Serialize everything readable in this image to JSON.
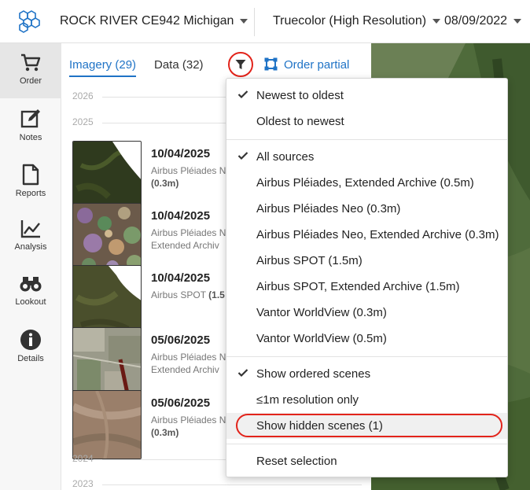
{
  "header": {
    "location": "ROCK RIVER CE942 Michigan",
    "layer": "Truecolor (High Resolution)",
    "date": "08/09/2022"
  },
  "nav": [
    {
      "label": "Order",
      "icon": "cart-icon"
    },
    {
      "label": "Notes",
      "icon": "edit-icon"
    },
    {
      "label": "Reports",
      "icon": "document-icon"
    },
    {
      "label": "Analysis",
      "icon": "line-chart-icon"
    },
    {
      "label": "Lookout",
      "icon": "binoculars-icon"
    },
    {
      "label": "Details",
      "icon": "info-icon"
    }
  ],
  "tabs": {
    "imagery": "Imagery (29)",
    "data": "Data (32)",
    "order_partial": "Order partial"
  },
  "years": [
    "2026",
    "2025",
    "2024",
    "2023"
  ],
  "scenes": [
    {
      "date": "10/04/2025",
      "source": "Airbus Pléiades N",
      "res": "(0.3m)",
      "extra": ""
    },
    {
      "date": "10/04/2025",
      "source": "Airbus Pléiades N",
      "res": "",
      "extra": "Extended Archiv"
    },
    {
      "date": "10/04/2025",
      "source": "Airbus SPOT",
      "res": "(1.5",
      "extra": ""
    },
    {
      "date": "05/06/2025",
      "source": "Airbus Pléiades N",
      "res": "",
      "extra": "Extended Archiv"
    },
    {
      "date": "05/06/2025",
      "source": "Airbus Pléiades N",
      "res": "(0.3m)",
      "extra": ""
    }
  ],
  "menu": {
    "sort": [
      {
        "label": "Newest to oldest",
        "checked": true
      },
      {
        "label": "Oldest to newest",
        "checked": false
      }
    ],
    "sources": [
      {
        "label": "All sources",
        "checked": true
      },
      {
        "label": "Airbus Pléiades, Extended Archive (0.5m)",
        "checked": false
      },
      {
        "label": "Airbus Pléiades Neo (0.3m)",
        "checked": false
      },
      {
        "label": "Airbus Pléiades Neo, Extended Archive (0.3m)",
        "checked": false
      },
      {
        "label": "Airbus SPOT (1.5m)",
        "checked": false
      },
      {
        "label": "Airbus SPOT, Extended Archive (1.5m)",
        "checked": false
      },
      {
        "label": "Vantor WorldView (0.3m)",
        "checked": false
      },
      {
        "label": "Vantor WorldView (0.5m)",
        "checked": false
      }
    ],
    "options": [
      {
        "label": "Show ordered scenes",
        "checked": true
      },
      {
        "label": "≤1m resolution only",
        "checked": false
      },
      {
        "label": "Show hidden scenes (1)",
        "checked": false
      }
    ],
    "reset": "Reset selection"
  },
  "colors": {
    "accent": "#1f73c6",
    "highlight_ring": "#e2231a"
  }
}
